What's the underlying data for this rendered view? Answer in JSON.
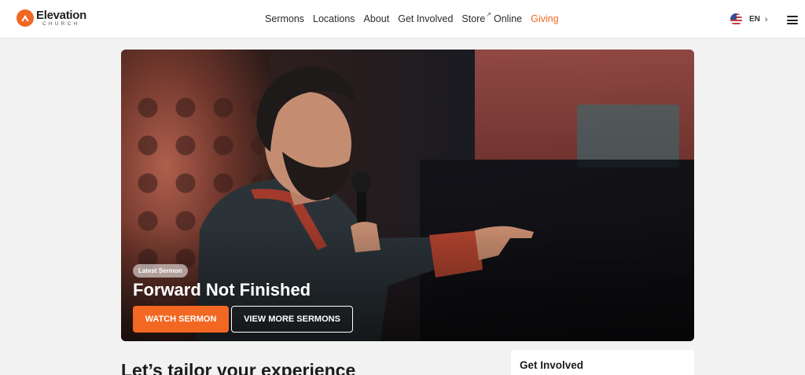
{
  "header": {
    "logo": {
      "word": "Elevation",
      "sub": "CHURCH"
    },
    "nav": [
      {
        "label": "Sermons"
      },
      {
        "label": "Locations"
      },
      {
        "label": "About"
      },
      {
        "label": "Get Involved"
      },
      {
        "label": "Store"
      },
      {
        "label": "Online"
      },
      {
        "label": "Giving"
      }
    ],
    "language": {
      "code": "EN",
      "flag_icon": "us-flag-icon"
    },
    "accent_color": "#f26722"
  },
  "hero": {
    "badge": "Latest Sermon",
    "title": "Forward Not Finished",
    "watch_button": "WATCH SERMON",
    "more_button": "VIEW MORE SERMONS"
  },
  "below": {
    "heading": "Let’s tailor your experience",
    "card_title": "Get Involved"
  }
}
